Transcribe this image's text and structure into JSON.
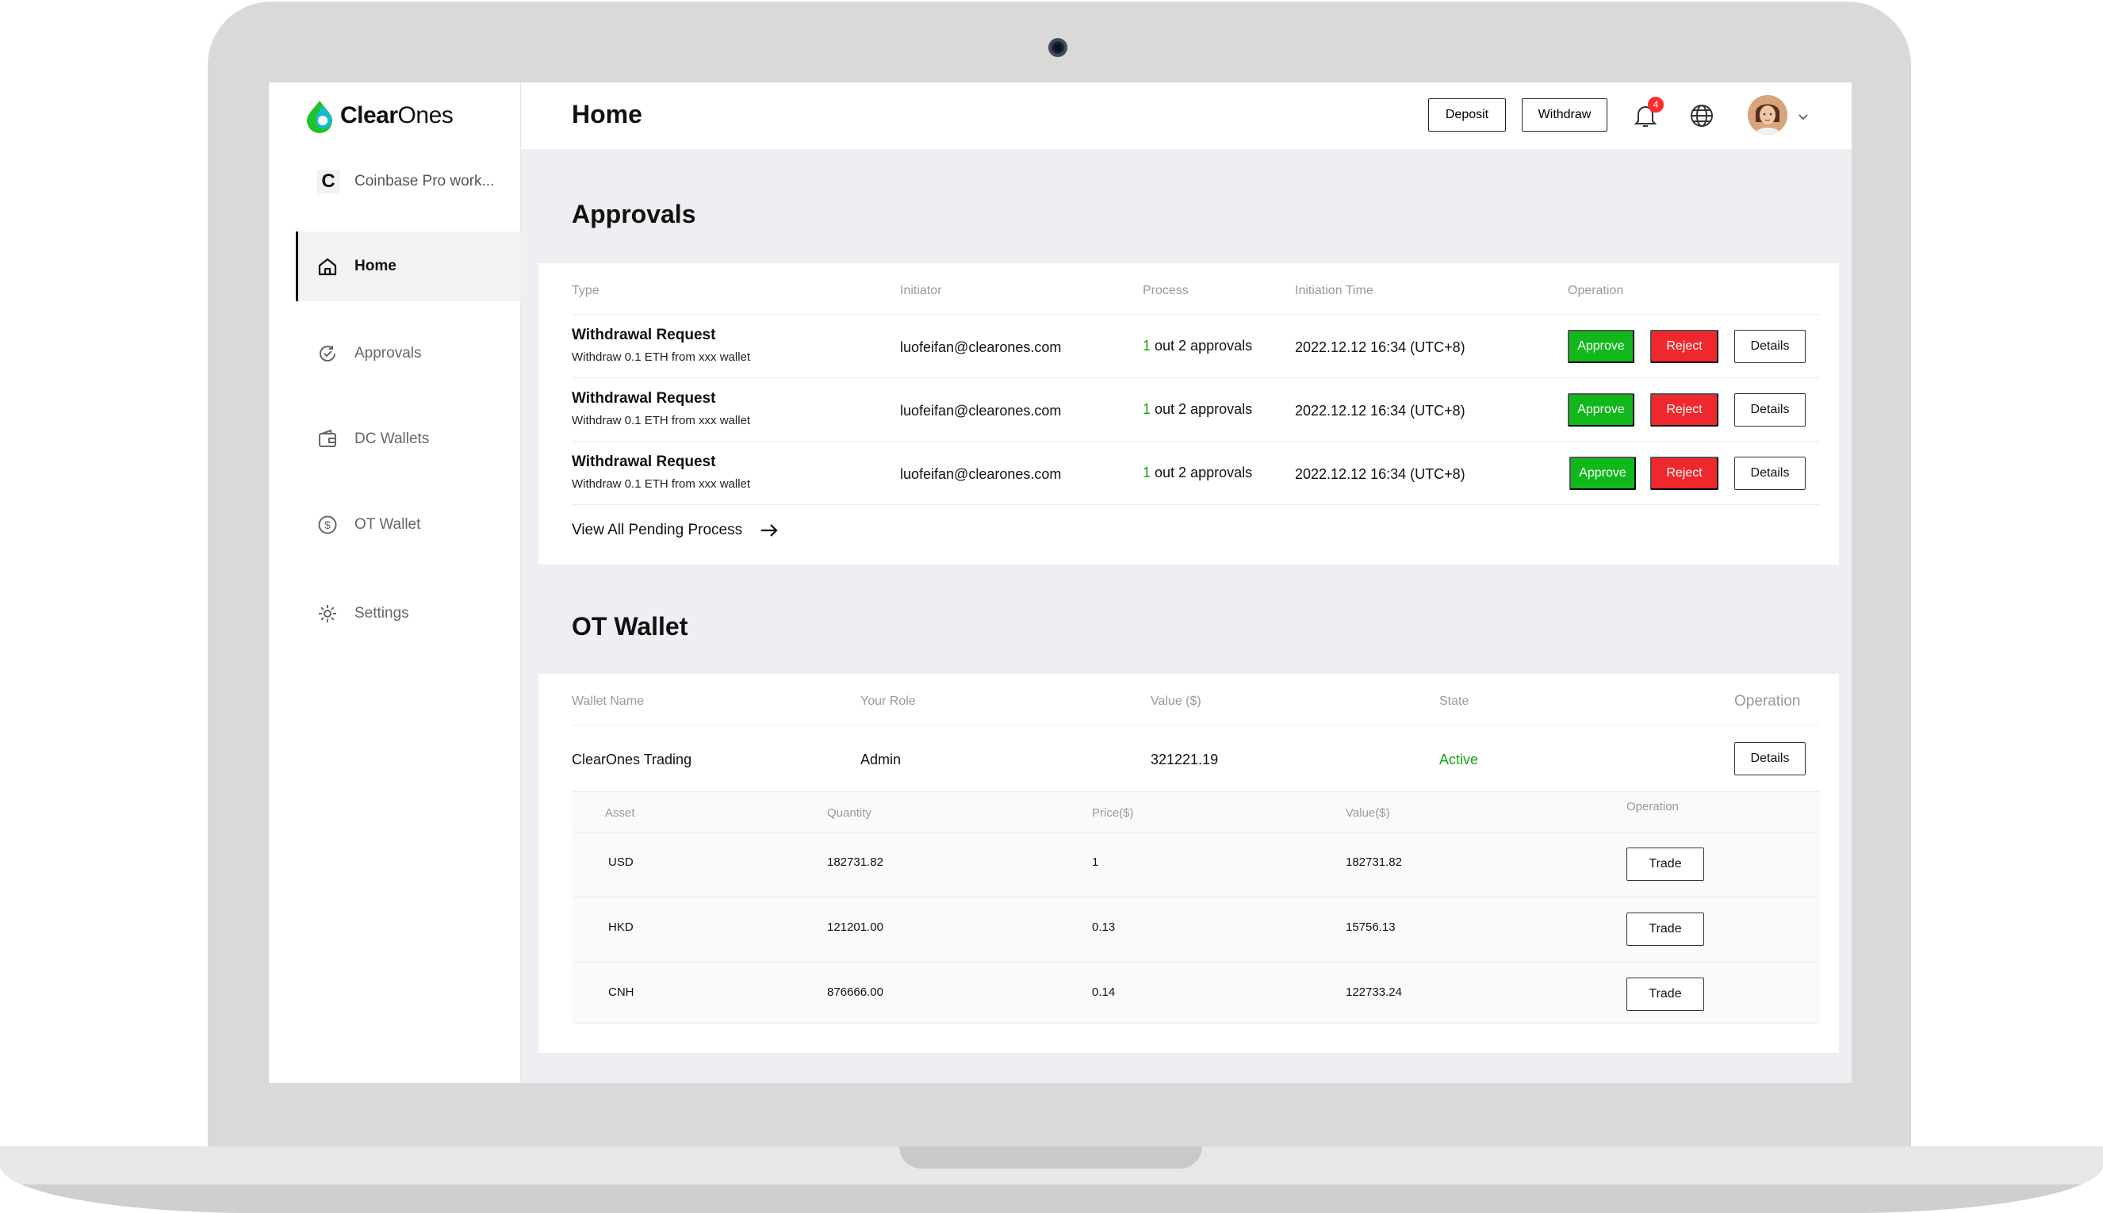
{
  "app": {
    "brand_bold": "Clear",
    "brand_light": "Ones",
    "workspace_badge": "C",
    "workspace_name": "Coinbase Pro work...",
    "accent_green": "#12b81b",
    "reject_red": "#f0282d"
  },
  "sidebar": {
    "items": [
      {
        "label": "Home",
        "icon": "home-icon",
        "active": true
      },
      {
        "label": "Approvals",
        "icon": "approvals-icon",
        "active": false
      },
      {
        "label": "DC Wallets",
        "icon": "wallet-icon",
        "active": false
      },
      {
        "label": "OT Wallet",
        "icon": "dollar-circle-icon",
        "active": false
      },
      {
        "label": "Settings",
        "icon": "gear-icon",
        "active": false
      }
    ]
  },
  "header": {
    "title": "Home",
    "deposit_label": "Deposit",
    "withdraw_label": "Withdraw",
    "notification_count": "4"
  },
  "approvals": {
    "title": "Approvals",
    "columns": [
      "Type",
      "Initiator",
      "Process",
      "Initiation Time",
      "Operation"
    ],
    "rows": [
      {
        "type": "Withdrawal Request",
        "detail": "Withdraw 0.1 ETH from xxx wallet",
        "initiator": "luofeifan@clearones.com",
        "process_count": "1",
        "process_text": " out 2 approvals",
        "time": "2022.12.12 16:34 (UTC+8)"
      },
      {
        "type": "Withdrawal Request",
        "detail": "Withdraw 0.1 ETH from xxx wallet",
        "initiator": "luofeifan@clearones.com",
        "process_count": "1",
        "process_text": " out 2 approvals",
        "time": "2022.12.12 16:34 (UTC+8)"
      },
      {
        "type": "Withdrawal Request",
        "detail": "Withdraw 0.1 ETH from xxx wallet",
        "initiator": "luofeifan@clearones.com",
        "process_count": "1",
        "process_text": " out 2 approvals",
        "time": "2022.12.12 16:34 (UTC+8)"
      }
    ],
    "approve_label": "Approve",
    "reject_label": "Reject",
    "details_label": "Details",
    "view_all_label": "View All Pending Process"
  },
  "ot_wallet": {
    "title": "OT Wallet",
    "columns": [
      "Wallet Name",
      "Your Role",
      "Value ($)",
      "State",
      "Operation"
    ],
    "wallet": {
      "name": "ClearOnes Trading",
      "role": "Admin",
      "value": "321221.19",
      "state": "Active",
      "details_label": "Details"
    },
    "asset_columns": [
      "Asset",
      "Quantity",
      "Price($)",
      "Value($)",
      "Operation"
    ],
    "assets": [
      {
        "asset": "USD",
        "quantity": "182731.82",
        "price": "1",
        "value": "182731.82"
      },
      {
        "asset": "HKD",
        "quantity": "121201.00",
        "price": "0.13",
        "value": "15756.13"
      },
      {
        "asset": "CNH",
        "quantity": "876666.00",
        "price": "0.14",
        "value": "122733.24"
      }
    ],
    "trade_label": "Trade"
  }
}
